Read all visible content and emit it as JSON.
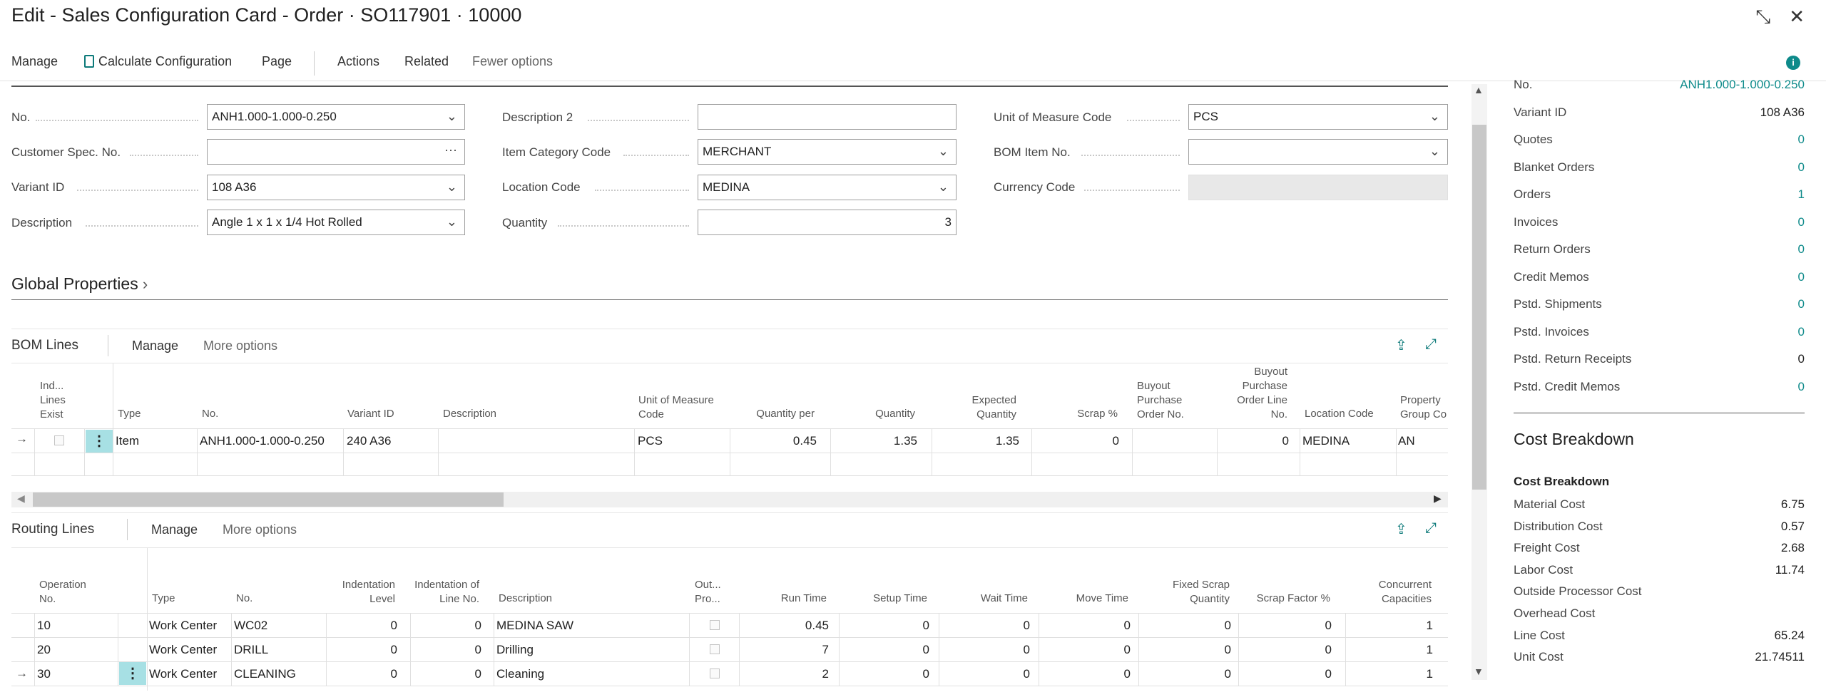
{
  "window": {
    "title": "Edit - Sales Configuration Card - Order · SO117901 · 10000"
  },
  "actionbar": {
    "manage": "Manage",
    "calculate": "Calculate Configuration",
    "page": "Page",
    "actions": "Actions",
    "related": "Related",
    "fewer": "Fewer options"
  },
  "general": {
    "no_label": "No.",
    "no_value": "ANH1.000-1.000-0.250",
    "cust_spec_label": "Customer Spec. No.",
    "cust_spec_value": "",
    "variant_label": "Variant ID",
    "variant_value": "108 A36",
    "desc_label": "Description",
    "desc_value": "Angle 1 x 1 x 1/4 Hot Rolled",
    "desc2_label": "Description 2",
    "desc2_value": "",
    "item_cat_label": "Item Category Code",
    "item_cat_value": "MERCHANT",
    "location_label": "Location Code",
    "location_value": "MEDINA",
    "qty_label": "Quantity",
    "qty_value": "3",
    "uom_label": "Unit of Measure Code",
    "uom_value": "PCS",
    "bom_item_label": "BOM Item No.",
    "bom_item_value": "",
    "currency_label": "Currency Code",
    "currency_value": ""
  },
  "global_properties": {
    "title": "Global Properties"
  },
  "bom_lines": {
    "title": "BOM Lines",
    "manage": "Manage",
    "more": "More options",
    "headers": {
      "ind": "Ind... Lines Exist",
      "type": "Type",
      "no": "No.",
      "variant": "Variant ID",
      "desc": "Description",
      "uom": "Unit of Measure Code",
      "qty_per": "Quantity per",
      "qty": "Quantity",
      "exp_qty": "Expected Quantity",
      "scrap": "Scrap %",
      "buyout_po": "Buyout Purchase Order No.",
      "buyout_pol": "Buyout Purchase Order Line No.",
      "location": "Location Code",
      "prop_group": "Property Group Co"
    },
    "row": {
      "type": "Item",
      "no": "ANH1.000-1.000-0.250",
      "variant": "240 A36",
      "desc": "",
      "uom": "PCS",
      "qty_per": "0.45",
      "qty": "1.35",
      "exp_qty": "1.35",
      "scrap": "0",
      "buyout_po": "",
      "buyout_pol": "0",
      "location": "MEDINA",
      "prop_group": "AN"
    }
  },
  "routing_lines": {
    "title": "Routing Lines",
    "manage": "Manage",
    "more": "More options",
    "headers": {
      "op_no": "Operation No.",
      "type": "Type",
      "no": "No.",
      "indent_level": "Indentation Level",
      "indent_line": "Indentation of Line No.",
      "desc": "Description",
      "out_pro": "Out... Pro...",
      "run_time": "Run Time",
      "setup_time": "Setup Time",
      "wait_time": "Wait Time",
      "move_time": "Move Time",
      "fixed_scrap": "Fixed Scrap Quantity",
      "scrap_factor": "Scrap Factor %",
      "concurrent": "Concurrent Capacities"
    },
    "rows": [
      {
        "op_no": "10",
        "type": "Work Center",
        "no": "WC02",
        "indent_level": "0",
        "indent_line": "0",
        "desc": "MEDINA SAW",
        "run_time": "0.45",
        "setup_time": "0",
        "wait_time": "0",
        "move_time": "0",
        "fixed_scrap": "0",
        "scrap_factor": "0",
        "concurrent": "1"
      },
      {
        "op_no": "20",
        "type": "Work Center",
        "no": "DRILL",
        "indent_level": "0",
        "indent_line": "0",
        "desc": "Drilling",
        "run_time": "7",
        "setup_time": "0",
        "wait_time": "0",
        "move_time": "0",
        "fixed_scrap": "0",
        "scrap_factor": "0",
        "concurrent": "1"
      },
      {
        "op_no": "30",
        "type": "Work Center",
        "no": "CLEANING",
        "indent_level": "0",
        "indent_line": "0",
        "desc": "Cleaning",
        "run_time": "2",
        "setup_time": "0",
        "wait_time": "0",
        "move_time": "0",
        "fixed_scrap": "0",
        "scrap_factor": "0",
        "concurrent": "1"
      }
    ]
  },
  "factbox": {
    "items": [
      {
        "label": "No.",
        "value": "ANH1.000-1.000-0.250",
        "link": true
      },
      {
        "label": "Variant ID",
        "value": "108 A36",
        "link": false
      },
      {
        "label": "Quotes",
        "value": "0",
        "link": true
      },
      {
        "label": "Blanket Orders",
        "value": "0",
        "link": true
      },
      {
        "label": "Orders",
        "value": "1",
        "link": true
      },
      {
        "label": "Invoices",
        "value": "0",
        "link": true
      },
      {
        "label": "Return Orders",
        "value": "0",
        "link": true
      },
      {
        "label": "Credit Memos",
        "value": "0",
        "link": true
      },
      {
        "label": "Pstd. Shipments",
        "value": "0",
        "link": true
      },
      {
        "label": "Pstd. Invoices",
        "value": "0",
        "link": true
      },
      {
        "label": "Pstd. Return Receipts",
        "value": "0",
        "link": false
      },
      {
        "label": "Pstd. Credit Memos",
        "value": "0",
        "link": true
      }
    ]
  },
  "cost_breakdown": {
    "title": "Cost Breakdown",
    "subtitle": "Cost Breakdown",
    "items": [
      {
        "label": "Material Cost",
        "value": "6.75"
      },
      {
        "label": "Distribution Cost",
        "value": "0.57"
      },
      {
        "label": "Freight Cost",
        "value": "2.68"
      },
      {
        "label": "Labor Cost",
        "value": "11.74"
      },
      {
        "label": "Outside Processor Cost",
        "value": ""
      },
      {
        "label": "Overhead Cost",
        "value": ""
      },
      {
        "label": "Line Cost",
        "value": "65.24"
      },
      {
        "label": "Unit Cost",
        "value": "21.74511"
      }
    ]
  },
  "colors": {
    "accent": "#0d8a8a",
    "selection": "#a7e0e4"
  }
}
